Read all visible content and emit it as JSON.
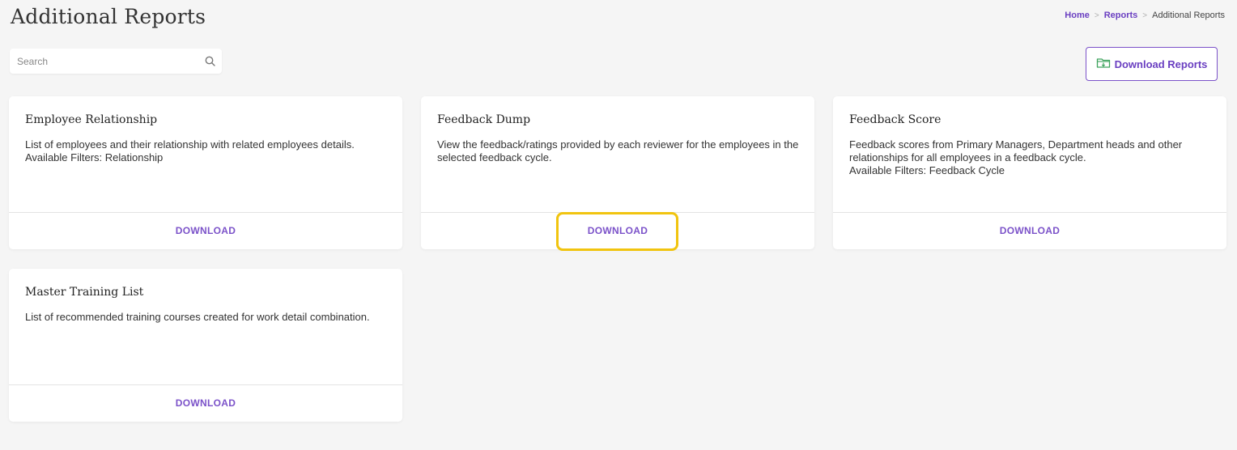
{
  "header": {
    "title": "Additional Reports",
    "breadcrumb": {
      "home": "Home",
      "reports": "Reports",
      "current": "Additional Reports",
      "separator": ">"
    }
  },
  "search": {
    "placeholder": "Search",
    "value": "",
    "icon": "search-icon"
  },
  "toolbar": {
    "download_reports_label": "Download Reports",
    "download_reports_icon": "folder-download-icon"
  },
  "cards": [
    {
      "title": "Employee Relationship",
      "description": "List of employees and their relationship with related employees details.",
      "filters": "Available Filters: Relationship",
      "action": "DOWNLOAD"
    },
    {
      "title": "Feedback Dump",
      "description": "View the feedback/ratings provided by each reviewer for the employees in the selected feedback cycle.",
      "filters": "",
      "action": "DOWNLOAD"
    },
    {
      "title": "Feedback Score",
      "description": "Feedback scores from Primary Managers, Department heads and other relationships for all employees in a feedback cycle.",
      "filters": "Available Filters: Feedback Cycle",
      "action": "DOWNLOAD"
    },
    {
      "title": "Master Training List",
      "description": "List of recommended training courses created for work detail combination.",
      "filters": "",
      "action": "DOWNLOAD"
    }
  ],
  "colors": {
    "accent": "#7b52c9",
    "highlight": "#f1c40f",
    "background": "#f5f5f5"
  }
}
